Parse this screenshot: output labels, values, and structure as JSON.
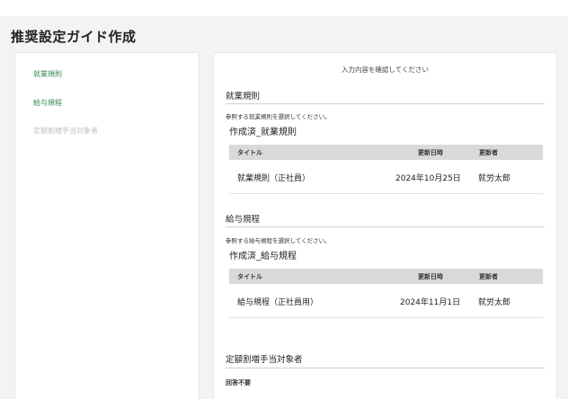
{
  "page": {
    "title": "推奨設定ガイド作成"
  },
  "sidebar": {
    "items": [
      {
        "label": "就業規則",
        "state": "active"
      },
      {
        "label": "給与規程",
        "state": "active"
      },
      {
        "label": "定額割増手当対象者",
        "state": "disabled"
      }
    ]
  },
  "main": {
    "instruction": "入力内容を確認してください",
    "sections": [
      {
        "title": "就業規則",
        "hint": "参照する就業規則を選択してください。",
        "table_title": "作成済_就業規則",
        "columns": [
          "タイトル",
          "更新日時",
          "更新者"
        ],
        "rows": [
          {
            "title": "就業規則（正社員）",
            "updated": "2024年10月25日",
            "updater": "就労太郎"
          }
        ]
      },
      {
        "title": "給与規程",
        "hint": "参照する給与規程を選択してください。",
        "table_title": "作成済_給与規程",
        "columns": [
          "タイトル",
          "更新日時",
          "更新者"
        ],
        "rows": [
          {
            "title": "給与規程（正社員用）",
            "updated": "2024年11月1日",
            "updater": "就労太郎"
          }
        ]
      },
      {
        "title": "定額割増手当対象者",
        "partial_label": "回答不要"
      }
    ]
  },
  "colors": {
    "accent_green": "#2f8a4e",
    "disabled_text": "#c0c0c0",
    "table_header_bg": "#d9d9d9"
  }
}
